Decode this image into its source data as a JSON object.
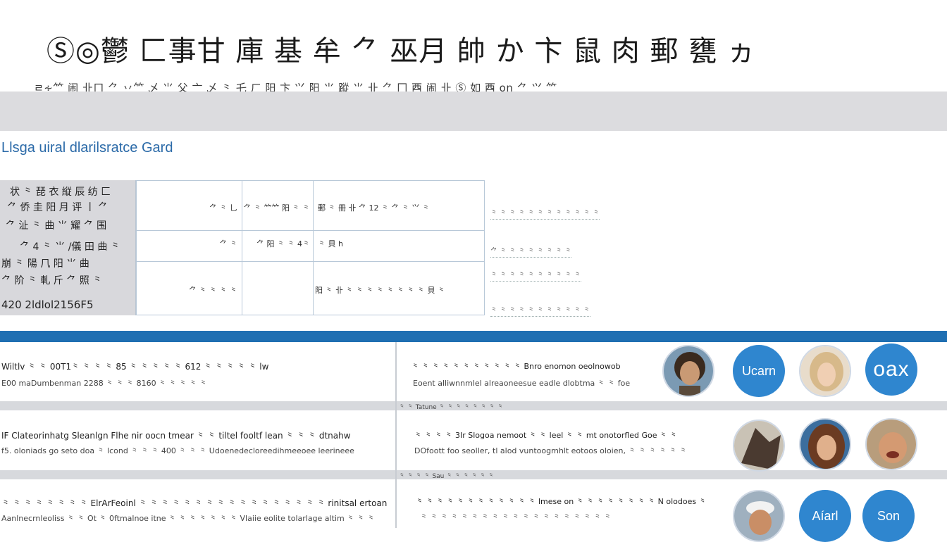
{
  "header": {
    "title": "Ⓢ◎鬱 匚事甘 庫 基 牟 ⺈ 巫月 帥 か 卞 鼠 肉 郵 甕 ヵ",
    "subtitle": "ㄹ∻⺮ 闹 卝ㄇ ⺈ 丷⺮ 乄 ⺌ 父 ⼇ 乄 ⺀ 乇 ㄏ 阳 卞 ⺍ 阳 ⺌ 蹤 ⺌ 卝 ⺈ 冂 ⾣ 闹 卝 Ⓢ 如 ⾣ on ⺈ ⺍ ⺮"
  },
  "card": {
    "title": "Llsga uiral dlarilsratce Gard"
  },
  "top_table": {
    "left_lines": [
      "状 ⺀ 琵 ⾐ 縦 ⾠ 纺 ⼕",
      "⺈ 侨 圭 阳 ⽉ 评 ⼁ ⺈",
      "⺈ 沚 ⺀ 曲 ⺌ 耀 ⺈ 围",
      "⺈ 4 ⺀ ⺌ /儀 ⽥ 曲 ⺀",
      "崩 ⺀ 陽 ⺇ 阳 ⺌ 曲",
      "⺈ 阶 ⺀ 軋 斤 ⺈ 照 ⺀",
      "420 2ldlol2156F5"
    ],
    "cells": {
      "r1c1": "⺈ ⺀ ⺃",
      "r1c2": "⺈ ⺀ ⺮⺮ 阳 ⺀ ⺀",
      "r1c3": "郵 ⺀ 冊 卝 ⺈ 12 ⺀ ⺈ ⺀ ⺍ ⺀",
      "r2c1": "⺈ ⺀",
      "r2c2": "⺈ 阳 ⺀ ⺀ 4⺀",
      "r2c3": "⺀ ⾙ h",
      "r3c1": "⺈ ⺀ ⺀ ⺀ ⺀",
      "r3c3": "阳 ⺀ 卝 ⺀ ⺀ ⺀ ⺀ ⺀ ⺀ ⺀ ⺀ ⾙ ⺀"
    },
    "notes": [
      "⺀ ⺀ ⺀ ⺀ ⺀ ⺀ ⺀ ⺀ ⺀ ⺀ ⺀ ⺀",
      "⺈ ⺀ ⺀ ⺀ ⺀ ⺀ ⺀ ⺀ ⺀",
      "⺀ ⺀ ⺀ ⺀ ⺀ ⺀ ⺀ ⺀ ⺀ ⺀",
      "⺀ ⺀ ⺀ ⺀ ⺀ ⺀ ⺀ ⺀ ⺀ ⺀ ⺀"
    ]
  },
  "rows": [
    {
      "left_line1": "Wiltlv ⺀ ⺀ 00T1⺀ ⺀ ⺀ ⺀ 85 ⺀ ⺀ ⺀ ⺀ ⺀ 612 ⺀ ⺀ ⺀ ⺀ ⺀ lw",
      "left_line2": "E00 maDumbenman 2288 ⺀ ⺀ ⺀ 8160 ⺀ ⺀ ⺀ ⺀ ⺀",
      "right_line1": "⺀ ⺀ ⺀ ⺀ ⺀ ⺀ ⺀ ⺀ ⺀ ⺀ ⺀ Bnro enomon oeolnowob",
      "right_line2": "Eoent alliwnnmlel alreaoneesue eadle dlobtma ⺀ ⺀ foe",
      "sep": "⺀ ⺀ Tatune ⺀ ⺀ ⺀ ⺀ ⺀ ⺀ ⺀ ⺀"
    },
    {
      "left_line1": "IF Clateorinhatg Sleanlgn Flhe nir oocn tmear ⺀ ⺀ tiltel fooltf lean ⺀ ⺀ ⺀ dtnahw",
      "left_line2": "f5. oloniads go seto doa ⺀ lcond ⺀ ⺀ ⺀ 400 ⺀ ⺀ ⺀ Udoenedecloreedihmeeoee leerineee",
      "right_line1": "⺀ ⺀ ⺀ ⺀ 3Ir Slogoa nemoot ⺀ ⺀ leel ⺀ ⺀ mt onotorfled Goe ⺀ ⺀",
      "right_line2": "DOfoott foo seoller, tl alod vuntoogmhlt eotoos oloien, ⺀ ⺀ ⺀ ⺀ ⺀ ⺀",
      "sep": "⺀ ⺀ ⺀ ⺀ Sau ⺀ ⺀ ⺀ ⺀ ⺀ ⺀"
    },
    {
      "left_line1": "⺀ ⺀ ⺀ ⺀ ⺀ ⺀ ⺀ ⺀ ElrArFeoinl ⺀ ⺀ ⺀ ⺀ ⺀ ⺀ ⺀ ⺀ ⺀ ⺀ ⺀ ⺀ ⺀ ⺀ ⺀ ⺀ ⺀ rinitsal ertoan",
      "left_line2": "Aanlnecrnleoliss ⺀ ⺀ Ot ⺀ 0ftmalnoe itne ⺀ ⺀ ⺀ ⺀ ⺀ ⺀ ⺀ Vlaiie eolite tolarlage altim ⺀ ⺀ ⺀",
      "right_line1": "⺀ ⺀ ⺀ ⺀ ⺀ ⺀ ⺀ ⺀ ⺀ ⺀ ⺀ ⺀ lmese on ⺀ ⺀ ⺀ ⺀ ⺀ ⺀ ⺀ ⺀ N olodoes ⺀",
      "right_line2": "⺀ ⺀ ⺀ ⺀ ⺀ ⺀ ⺀ ⺀ ⺀ ⺀ ⺀ ⺀ ⺀ ⺀ ⺀ ⺀ ⺀ ⺀ ⺀"
    }
  ],
  "avatars": {
    "row1": [
      {
        "kind": "photo",
        "name": "avatar-curly-man"
      },
      {
        "kind": "bubble",
        "label": "Ucarn"
      },
      {
        "kind": "photo",
        "name": "avatar-blonde-woman"
      },
      {
        "kind": "bubble",
        "label": "oax"
      }
    ],
    "row2": [
      {
        "kind": "photo",
        "name": "avatar-dark-figure"
      },
      {
        "kind": "photo",
        "name": "avatar-brunette-woman"
      },
      {
        "kind": "photo",
        "name": "avatar-laughing-man"
      }
    ],
    "row3": [
      {
        "kind": "photo",
        "name": "avatar-man-with-cap"
      },
      {
        "kind": "bubble",
        "label": "Aíarl"
      },
      {
        "kind": "bubble",
        "label": "Son"
      }
    ]
  },
  "colors": {
    "accent_blue": "#1f6fb2",
    "bubble_blue": "#2f86cf",
    "card_title": "#2b6aa8",
    "band_gray": "#dcdcdf"
  }
}
